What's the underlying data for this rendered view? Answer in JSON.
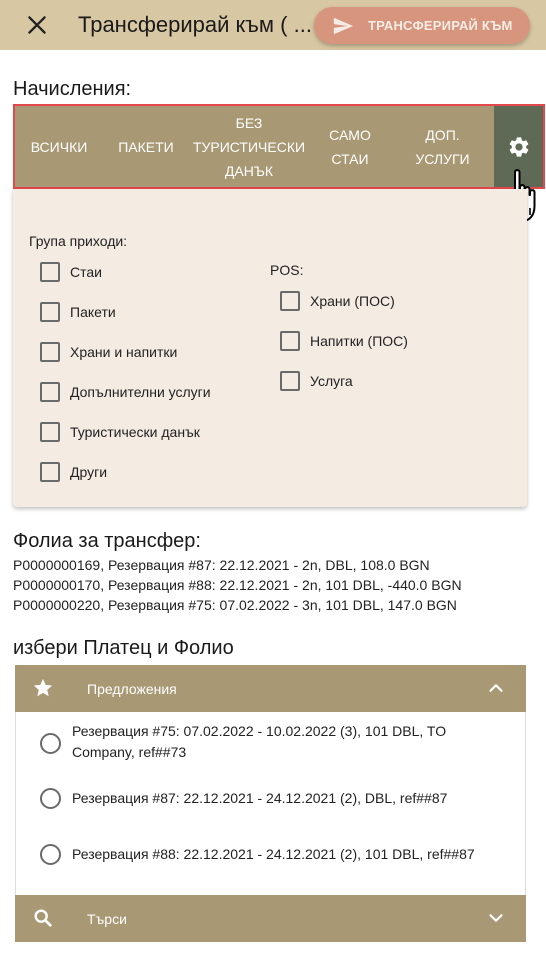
{
  "header": {
    "title": "Трансферирай към ( ...",
    "transfer_button": "ТРАНСФЕРИРАЙ КЪМ"
  },
  "charges": {
    "label": "Начисления:",
    "tabs": [
      {
        "label": "ВСИЧКИ"
      },
      {
        "label": "ПАКЕТИ"
      },
      {
        "label": "БЕЗ\nТУРИСТИЧЕСКИ\nДАНЪК"
      },
      {
        "label": "САМО\nСТАИ"
      },
      {
        "label": "ДОП.\nУСЛУГИ"
      }
    ],
    "settings_icon": "gear-icon",
    "filter": {
      "income_group_label": "Група приходи:",
      "income_group": [
        "Стаи",
        "Пакети",
        "Храни и напитки",
        "Допълнителни услуги",
        "Туристически данък",
        "Други"
      ],
      "pos_label": "POS:",
      "pos": [
        "Храни (ПОС)",
        "Напитки (ПОС)",
        "Услуга"
      ]
    }
  },
  "folios": {
    "label": "Фолиа за трансфер:",
    "items": [
      "P0000000169, Резервация #87: 22.12.2021 - 2n, DBL, 108.0 BGN",
      "P0000000170, Резервация #88: 22.12.2021 - 2n, 101 DBL, -440.0 BGN",
      "P0000000220, Резервация #75: 07.02.2022 - 3n, 101 DBL, 147.0 BGN"
    ]
  },
  "payer": {
    "label": "избери Платец и Фолио",
    "suggestions_label": "Предложения",
    "search_label": "Търси",
    "options": [
      "Резервация #75: 07.02.2022 - 10.02.2022 (3), 101 DBL, TO Company, ref##73",
      "Резервация #87: 22.12.2021 - 24.12.2021 (2), DBL, ref##87",
      "Резервация #88: 22.12.2021 - 24.12.2021 (2), 101 DBL, ref##87"
    ]
  },
  "colors": {
    "header_bg": "#d8c7a3",
    "accent_button": "#d6957c",
    "tab_bg": "#a89874",
    "tab_active": "#5e6a55",
    "panel_bg": "#f4ebe2",
    "highlight_border": "#e2474b"
  }
}
